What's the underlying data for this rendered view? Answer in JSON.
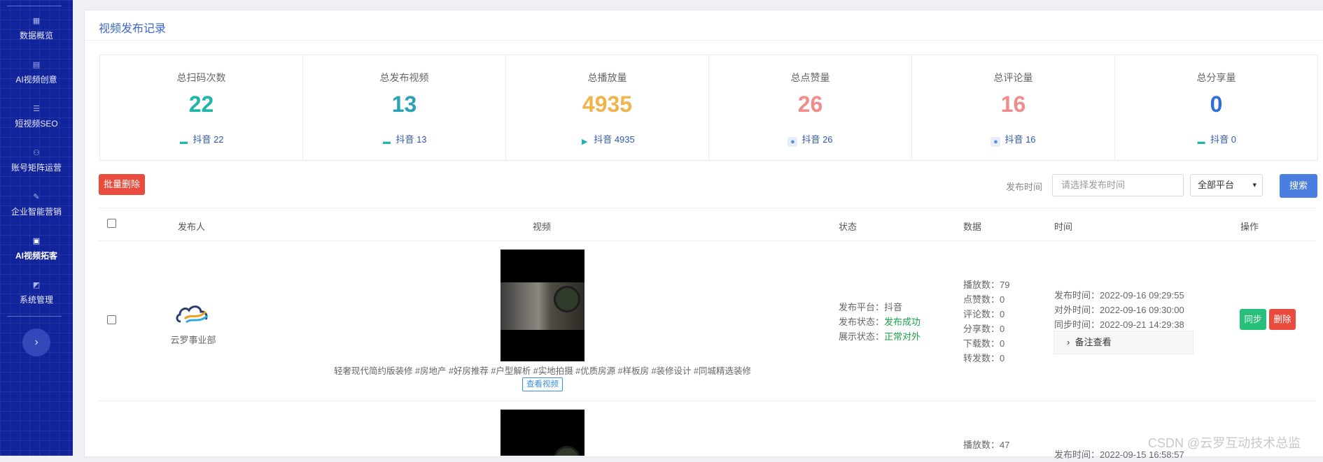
{
  "sidebar": {
    "items": [
      {
        "label": "数据概览",
        "icon": "dashboard-icon"
      },
      {
        "label": "AI视频创意",
        "icon": "document-icon"
      },
      {
        "label": "短视频SEO",
        "icon": "list-icon"
      },
      {
        "label": "账号矩阵运营",
        "icon": "people-icon"
      },
      {
        "label": "企业智能营销",
        "icon": "pen-icon"
      },
      {
        "label": "AI视频拓客",
        "icon": "inbox-icon"
      },
      {
        "label": "系统管理",
        "icon": "edit-icon"
      }
    ],
    "active_index": 5,
    "collapse_icon": "chevron-right-icon"
  },
  "page": {
    "title": "视频发布记录"
  },
  "stats": [
    {
      "label": "总扫码次数",
      "value": "22",
      "color": "#1fb6a8",
      "sub": "抖音 22",
      "sub_icon": "comment-icon"
    },
    {
      "label": "总发布视频",
      "value": "13",
      "color": "#2aa3b6",
      "sub": "抖音 13",
      "sub_icon": "comment-icon"
    },
    {
      "label": "总播放量",
      "value": "4935",
      "color": "#f0b44a",
      "sub": "抖音 4935",
      "sub_icon": "play-icon"
    },
    {
      "label": "总点赞量",
      "value": "26",
      "color": "#f28c8c",
      "sub": "抖音 26",
      "sub_icon": "user-icon"
    },
    {
      "label": "总评论量",
      "value": "16",
      "color": "#f28c8c",
      "sub": "抖音 16",
      "sub_icon": "user-icon"
    },
    {
      "label": "总分享量",
      "value": "0",
      "color": "#2f6fd6",
      "sub": "抖音 0",
      "sub_icon": "comment-icon"
    }
  ],
  "toolbar": {
    "batch_delete_label": "批量删除",
    "publish_time_label": "发布时间",
    "date_placeholder": "请选择发布时间",
    "platform_selected": "全部平台",
    "search_label": "搜索"
  },
  "table": {
    "headers": [
      "发布人",
      "视频",
      "状态",
      "数据",
      "时间",
      "操作"
    ],
    "rows": [
      {
        "publisher": "云罗事业部",
        "description": "轻奢现代简约版装修 #房地产 #好房推荐 #户型解析 #实地拍摄 #优质房源 #样板房 #装修设计 #同城精选装修",
        "view_label": "查看视频",
        "status": {
          "platform_label": "发布平台：",
          "platform": "抖音",
          "publish_label": "发布状态：",
          "publish": "发布成功",
          "display_label": "展示状态：",
          "display": "正常对外"
        },
        "data": [
          "播放数：79",
          "点赞数：0",
          "评论数：0",
          "分享数：0",
          "下载数：0",
          "转发数：0"
        ],
        "times": [
          "发布时间：2022-09-16 09:29:55",
          "对外时间：2022-09-16 09:30:00",
          "同步时间：2022-09-21 14:29:38"
        ],
        "note_label": "备注查看",
        "sync_label": "同步",
        "delete_label": "删除"
      },
      {
        "data_first": "播放数：47",
        "time_first": "发布时间：2022-09-15 16:58:57"
      }
    ]
  },
  "watermark": "CSDN @云罗互动技术总监"
}
